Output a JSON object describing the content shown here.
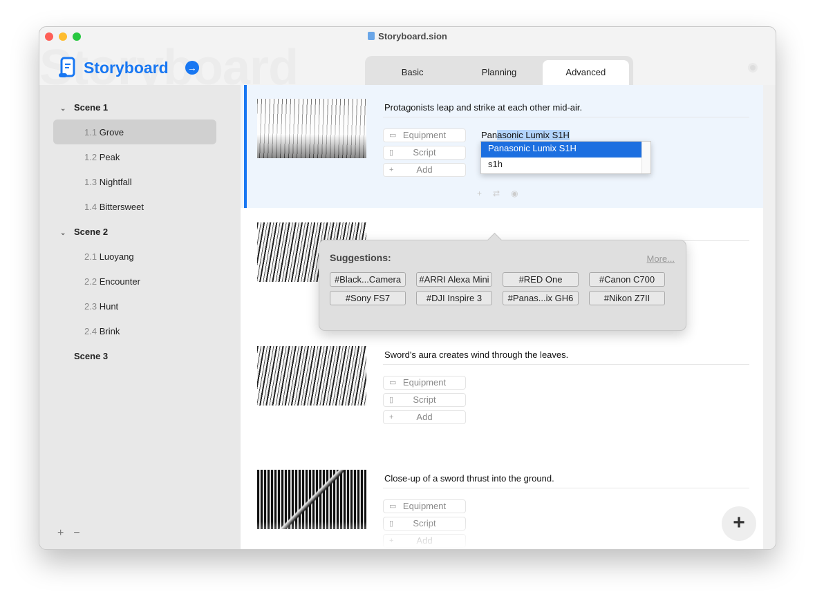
{
  "window": {
    "title": "Storyboard.sion"
  },
  "brand": {
    "name": "Storyboard",
    "watermark": "Storyboard"
  },
  "tabs": [
    {
      "label": "Basic"
    },
    {
      "label": "Planning"
    },
    {
      "label": "Advanced"
    }
  ],
  "sidebar": {
    "scenes": [
      {
        "label": "Scene 1",
        "shots": [
          {
            "num": "1.1",
            "name": "Grove"
          },
          {
            "num": "1.2",
            "name": "Peak"
          },
          {
            "num": "1.3",
            "name": "Nightfall"
          },
          {
            "num": "1.4",
            "name": "Bittersweet"
          }
        ]
      },
      {
        "label": "Scene 2",
        "shots": [
          {
            "num": "2.1",
            "name": "Luoyang"
          },
          {
            "num": "2.2",
            "name": "Encounter"
          },
          {
            "num": "2.3",
            "name": "Hunt"
          },
          {
            "num": "2.4",
            "name": "Brink"
          }
        ]
      },
      {
        "label": "Scene 3"
      }
    ],
    "add": "+",
    "remove": "−"
  },
  "buttons": {
    "equipment": "Equipment",
    "script": "Script",
    "add": "Add"
  },
  "cards": [
    {
      "description": "Protagonists leap and strike at each other mid-air.",
      "equipment_value_pre": "Pan",
      "equipment_value_sel": "asonic Lumix S1H"
    },
    {
      "description": ""
    },
    {
      "description": "Sword's aura creates wind through the leaves."
    },
    {
      "description": "Close-up of a sword thrust into the ground."
    }
  ],
  "autocomplete": {
    "options": [
      "Panasonic Lumix S1H",
      "s1h"
    ]
  },
  "suggestions": {
    "title": "Suggestions:",
    "more": "More...",
    "chips": [
      "#Black...Camera",
      "#ARRI Alexa Mini",
      "#RED One",
      "#Canon C700",
      "#Sony FS7",
      "#DJI Inspire 3",
      "#Panas...ix GH6",
      "#Nikon Z7II"
    ]
  },
  "fab": "+",
  "colors": {
    "accent": "#1877f2",
    "selection": "#1c6fe0"
  }
}
